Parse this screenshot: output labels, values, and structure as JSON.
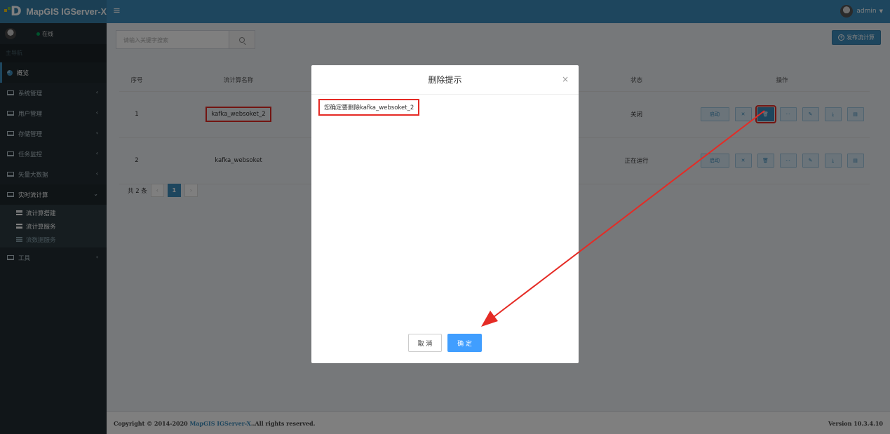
{
  "header": {
    "brand_title": "MapGIS IGServer-X",
    "user": "admin"
  },
  "sidebar": {
    "status": "在线",
    "nav_header": "主导航",
    "items": [
      {
        "label": "概览"
      },
      {
        "label": "系统管理"
      },
      {
        "label": "用户管理"
      },
      {
        "label": "存储管理"
      },
      {
        "label": "任务监控"
      },
      {
        "label": "矢量大数据"
      },
      {
        "label": "实时流计算"
      },
      {
        "label": "工具"
      }
    ],
    "subitems": [
      {
        "label": "流计算搭建"
      },
      {
        "label": "流计算服务"
      },
      {
        "label": "流数据服务"
      }
    ]
  },
  "main": {
    "search_placeholder": "请输入关键字搜索",
    "publish_label": "发布流计算",
    "columns": {
      "no": "序号",
      "name": "流计算名称",
      "status": "状态",
      "ops": "操作"
    },
    "rows": [
      {
        "no": "1",
        "name": "kafka_websoket_2",
        "status": "关闭",
        "start": "启动"
      },
      {
        "no": "2",
        "name": "kafka_websoket",
        "status": "正在运行",
        "start": "启动"
      }
    ],
    "pager": {
      "total": "共 2 条",
      "current": "1"
    }
  },
  "footer": {
    "copyright_prefix": "Copyright © 2014-2020 ",
    "brand": "MapGIS IGServer-X",
    "copyright_suffix": "..All rights reserved.",
    "version": "Version 10.3.4.10"
  },
  "modal": {
    "title": "删除提示",
    "message": "您确定要删除kafka_websoket_2",
    "cancel": "取 消",
    "ok": "确 定"
  },
  "colors": {
    "primary": "#3c8dbc",
    "sidebar": "#222d32",
    "highlight": "#e52b25",
    "confirm": "#409eff"
  }
}
